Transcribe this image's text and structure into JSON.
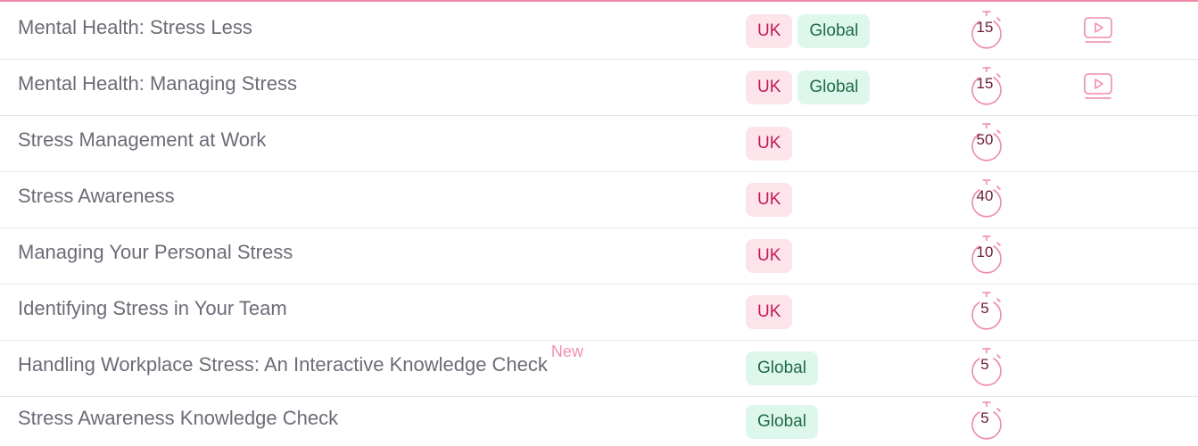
{
  "courses": [
    {
      "title": "Mental Health: Stress Less",
      "new": "",
      "regions": [
        "UK",
        "Global"
      ],
      "duration": "15",
      "video": true
    },
    {
      "title": "Mental Health: Managing Stress",
      "new": "",
      "regions": [
        "UK",
        "Global"
      ],
      "duration": "15",
      "video": true
    },
    {
      "title": "Stress Management at Work",
      "new": "",
      "regions": [
        "UK"
      ],
      "duration": "50",
      "video": false
    },
    {
      "title": "Stress Awareness",
      "new": "",
      "regions": [
        "UK"
      ],
      "duration": "40",
      "video": false
    },
    {
      "title": "Managing Your Personal Stress",
      "new": "",
      "regions": [
        "UK"
      ],
      "duration": "10",
      "video": false
    },
    {
      "title": "Identifying Stress in Your Team",
      "new": "",
      "regions": [
        "UK"
      ],
      "duration": "5",
      "video": false
    },
    {
      "title": "Handling Workplace Stress: An Interactive Knowledge Check",
      "new": "New",
      "regions": [
        "Global"
      ],
      "duration": "5",
      "video": false
    },
    {
      "title": "Stress Awareness Knowledge Check",
      "new": "",
      "regions": [
        "Global"
      ],
      "duration": "5",
      "video": false
    }
  ],
  "colors": {
    "accent": "#f08aa8",
    "uk_bg": "#fde4ea",
    "uk_text": "#c2185b",
    "global_bg": "#def7ec",
    "global_text": "#1f6b46"
  },
  "icons": {
    "duration": "stopwatch-icon",
    "video": "video-icon"
  }
}
